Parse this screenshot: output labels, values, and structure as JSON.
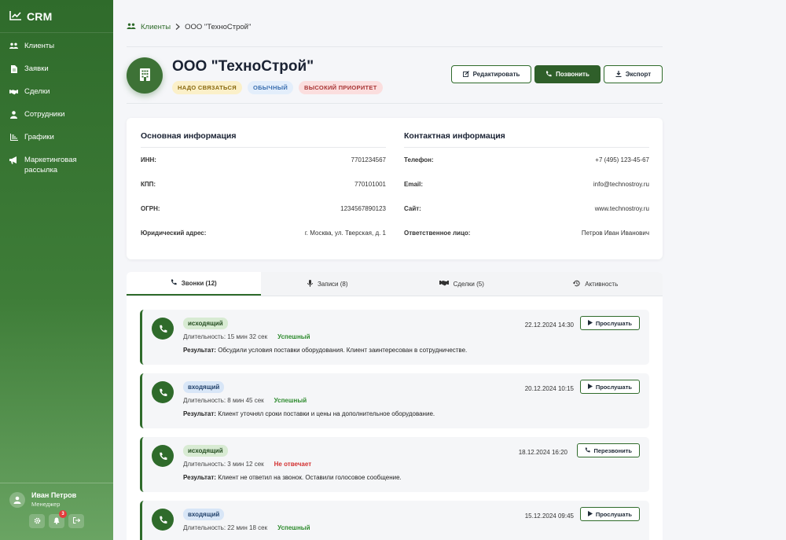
{
  "app": {
    "name": "CRM"
  },
  "sidebar": {
    "items": [
      {
        "label": "Клиенты",
        "icon": "users-icon"
      },
      {
        "label": "Заявки",
        "icon": "document-icon"
      },
      {
        "label": "Сделки",
        "icon": "handshake-icon"
      },
      {
        "label": "Сотрудники",
        "icon": "person-icon"
      },
      {
        "label": "Графики",
        "icon": "chart-icon"
      },
      {
        "label": "Маркетинговая рассылка",
        "icon": "megaphone-icon"
      }
    ],
    "user": {
      "name": "Иван Петров",
      "role": "Менеджер",
      "notifications": "3"
    }
  },
  "breadcrumb": {
    "parent": "Клиенты",
    "current": "ООО \"ТехноСтрой\""
  },
  "company": {
    "name": "ООО \"ТехноСтрой\"",
    "tags": [
      {
        "label": "НАДО СВЯЗАТЬСЯ",
        "style": "yellow"
      },
      {
        "label": "ОБЫЧНЫЙ",
        "style": "blue"
      },
      {
        "label": "ВЫСОКИЙ ПРИОРИТЕТ",
        "style": "red"
      }
    ],
    "actions": {
      "edit": "Редактировать",
      "call": "Позвонить",
      "export": "Экспорт"
    }
  },
  "info": {
    "basic": {
      "title": "Основная информация",
      "rows": [
        {
          "label": "ИНН:",
          "value": "7701234567"
        },
        {
          "label": "КПП:",
          "value": "770101001"
        },
        {
          "label": "ОГРН:",
          "value": "1234567890123"
        },
        {
          "label": "Юридический адрес:",
          "value": "г. Москва, ул. Тверская, д. 1"
        }
      ]
    },
    "contact": {
      "title": "Контактная информация",
      "rows": [
        {
          "label": "Телефон:",
          "value": "+7 (495) 123-45-67"
        },
        {
          "label": "Email:",
          "value": "info@technostroy.ru"
        },
        {
          "label": "Сайт:",
          "value": "www.technostroy.ru"
        },
        {
          "label": "Ответственное лицо:",
          "value": "Петров Иван Иванович"
        }
      ]
    }
  },
  "tabs": [
    {
      "label": "Звонки (12)",
      "icon": "phone-icon",
      "active": true
    },
    {
      "label": "Записи (8)",
      "icon": "microphone-icon",
      "active": false
    },
    {
      "label": "Сделки (5)",
      "icon": "handshake-icon",
      "active": false
    },
    {
      "label": "Активность",
      "icon": "history-icon",
      "active": false
    }
  ],
  "calls": [
    {
      "direction": "исходящий",
      "dir_type": "out",
      "duration": "Длительность: 15 мин 32 сек",
      "status": "Успешный",
      "status_type": "ok",
      "result_label": "Результат:",
      "result": "Обсудили условия поставки оборудования. Клиент заинтересован в сотрудничестве.",
      "date": "22.12.2024 14:30",
      "action": "Прослушать"
    },
    {
      "direction": "входящий",
      "dir_type": "in",
      "duration": "Длительность: 8 мин 45 сек",
      "status": "Успешный",
      "status_type": "ok",
      "result_label": "Результат:",
      "result": "Клиент уточнял сроки поставки и цены на дополнительное оборудование.",
      "date": "20.12.2024 10:15",
      "action": "Прослушать"
    },
    {
      "direction": "исходящий",
      "dir_type": "out",
      "duration": "Длительность: 3 мин 12 сек",
      "status": "Не отвечает",
      "status_type": "no",
      "result_label": "Результат:",
      "result": "Клиент не ответил на звонок. Оставили голосовое сообщение.",
      "date": "18.12.2024 16:20",
      "action": "Перезвонить"
    },
    {
      "direction": "входящий",
      "dir_type": "in",
      "duration": "Длительность: 22 мин 18 сек",
      "status": "Успешный",
      "status_type": "ok",
      "result_label": "",
      "result": "",
      "date": "15.12.2024 09:45",
      "action": "Прослушать"
    }
  ]
}
